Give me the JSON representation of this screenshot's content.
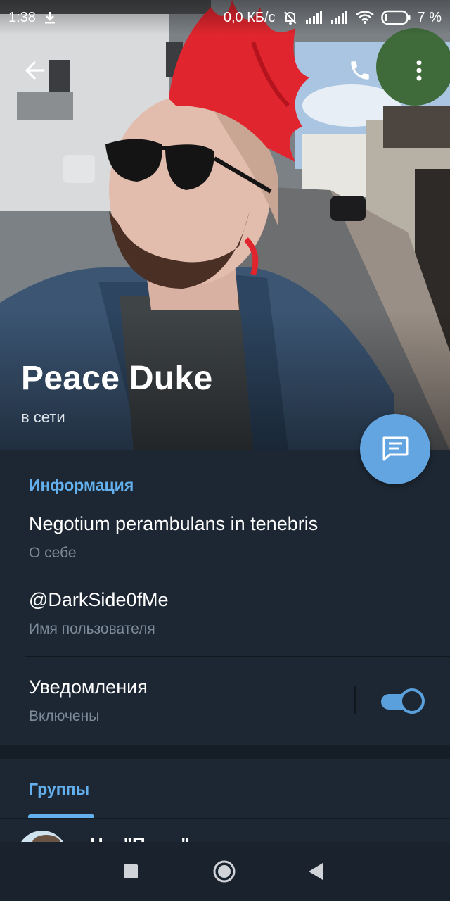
{
  "status_bar": {
    "time": "1:38",
    "network_speed": "0,0 КБ/с",
    "battery": "7 %",
    "icons": [
      "download-icon",
      "bell-off-icon",
      "signal-icon",
      "signal-icon",
      "wifi-icon",
      "battery-icon"
    ]
  },
  "header": {
    "back_icon": "arrow-left-icon",
    "call_icon": "phone-icon",
    "more_icon": "more-vertical-icon"
  },
  "profile": {
    "name": "Peace Duke",
    "status": "в сети"
  },
  "fab": {
    "icon": "message-icon"
  },
  "info": {
    "section_title": "Информация",
    "bio": "Negotium perambulans in tenebris",
    "bio_label": "О себе",
    "username": "@DarkSide0fMe",
    "username_label": "Имя пользователя",
    "notifications": "Уведомления",
    "notifications_state": "Включены",
    "notifications_enabled": true
  },
  "groups": {
    "section_title": "Группы",
    "first_group_name": "Н... \"П... ...\""
  },
  "navbar": {
    "icons": [
      "square-icon",
      "circle-icon",
      "back-triangle-icon"
    ]
  },
  "colors": {
    "background": "#1d2733",
    "accent": "#64b0ee",
    "fab": "#62a5e0",
    "hair": "#e0252e"
  }
}
